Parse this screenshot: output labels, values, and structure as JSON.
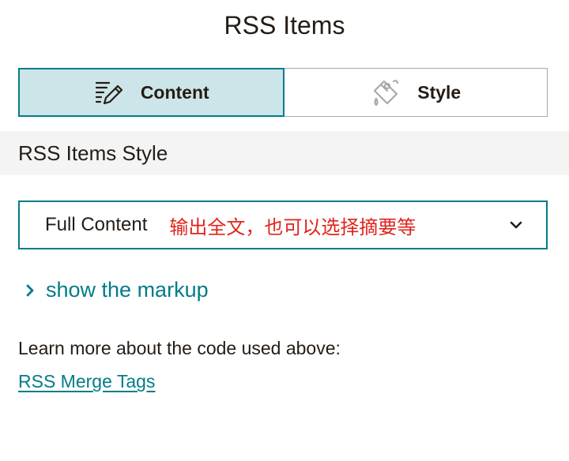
{
  "header": {
    "title": "RSS Items"
  },
  "tabs": [
    {
      "label": "Content",
      "icon": "edit-lines-icon",
      "active": true
    },
    {
      "label": "Style",
      "icon": "paint-bucket-icon",
      "active": false
    }
  ],
  "section": {
    "title": "RSS Items Style"
  },
  "content_select": {
    "value": "Full Content",
    "annotation": "输出全文，也可以选择摘要等",
    "icon": "chevron-down-icon"
  },
  "markup_toggle": {
    "label": "show the markup",
    "icon": "chevron-right-icon"
  },
  "help": {
    "text": "Learn more about the code used above:",
    "link_label": "RSS Merge Tags"
  },
  "colors": {
    "accent": "#007c89",
    "active_tab_bg": "#cce5e8",
    "annotation": "#e0241b",
    "section_bg": "#f4f4f4"
  }
}
